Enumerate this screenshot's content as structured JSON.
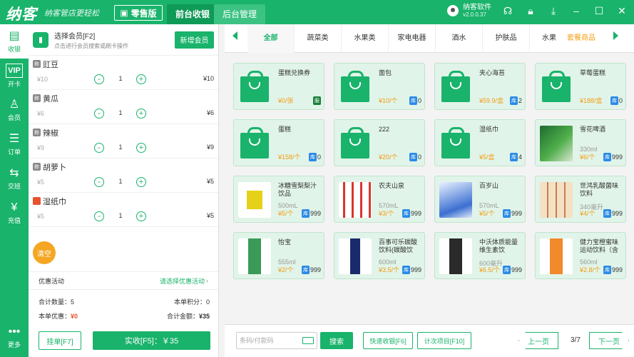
{
  "topbar": {
    "logo": "纳客",
    "slogan": "纳客管店更轻松",
    "edition": "零售版",
    "tabs": [
      "前台收银",
      "后台管理"
    ],
    "user_name": "纳客软件",
    "version": "v2.0.0.37",
    "icons": [
      "headset-icon",
      "lock-icon",
      "download-icon",
      "minimize-icon",
      "maximize-icon",
      "close-icon"
    ]
  },
  "sidebar": {
    "items": [
      {
        "label": "收银",
        "icon": "cashier-icon"
      },
      {
        "label": "开卡",
        "icon": "vip-icon"
      },
      {
        "label": "会员",
        "icon": "member-icon"
      },
      {
        "label": "订单",
        "icon": "order-icon"
      },
      {
        "label": "交班",
        "icon": "shift-icon"
      },
      {
        "label": "充值",
        "icon": "recharge-icon"
      }
    ],
    "more": "更多"
  },
  "member": {
    "title": "选择会员[F2]",
    "subtitle": "点击进行会员搜索或刷卡操作",
    "add_button": "新增会员"
  },
  "cart": {
    "items": [
      {
        "tag": "称",
        "name": "豇豆",
        "price": "¥10",
        "qty": "1",
        "total": "¥10"
      },
      {
        "tag": "称",
        "name": "黄瓜",
        "price": "¥6",
        "qty": "1",
        "total": "¥6"
      },
      {
        "tag": "称",
        "name": "辣椒",
        "price": "¥9",
        "qty": "1",
        "total": "¥9"
      },
      {
        "tag": "称",
        "name": "胡萝卜",
        "price": "¥5",
        "qty": "1",
        "total": "¥5"
      },
      {
        "tag": "普",
        "name": "湿纸巾",
        "price": "¥5",
        "qty": "1",
        "total": "¥5"
      }
    ],
    "clear": "清空",
    "promo_label": "优惠活动",
    "promo_link": "请选择优惠活动",
    "total_qty_label": "合计数量：",
    "total_qty": "5",
    "points_label": "本单积分：",
    "points": "0",
    "discount_label": "本单优惠：",
    "discount": "¥0",
    "total_amount_label": "合计金额：",
    "total_amount": "¥35",
    "hang_button": "挂单[F7]",
    "pay_button": "实收[F5]：￥35"
  },
  "categories": {
    "items": [
      "全部",
      "蔬菜类",
      "水果类",
      "家电电器",
      "酒水",
      "护肤品",
      "水果"
    ],
    "active": "全部",
    "extra": "套餐商品"
  },
  "products": [
    {
      "name": "蛋糕兑换券",
      "spec": "",
      "price": "¥0/张",
      "badge": "服",
      "stock": ""
    },
    {
      "name": "面包",
      "spec": "",
      "price": "¥10/个",
      "badge": "库",
      "stock": "0"
    },
    {
      "name": "夹心海苔",
      "spec": "",
      "price": "¥59.9/盒",
      "badge": "库",
      "stock": "2"
    },
    {
      "name": "草莓蛋糕",
      "spec": "",
      "price": "¥188/盒",
      "badge": "库",
      "stock": "0"
    },
    {
      "name": "蛋糕",
      "spec": "",
      "price": "¥158/个",
      "badge": "库",
      "stock": "0"
    },
    {
      "name": "222",
      "spec": "",
      "price": "¥20/个",
      "badge": "库",
      "stock": "0"
    },
    {
      "name": "湿纸巾",
      "spec": "",
      "price": "¥5/盒",
      "badge": "库",
      "stock": "4"
    },
    {
      "name": "雪花啤酒",
      "spec": "330ml",
      "price": "¥6/个",
      "badge": "库",
      "stock": "999"
    },
    {
      "name": "冰糖雪梨梨汁饮品",
      "spec": "500mL",
      "price": "¥5/个",
      "badge": "库",
      "stock": "999"
    },
    {
      "name": "农夫山泉",
      "spec": "570mL",
      "price": "¥3/个",
      "badge": "库",
      "stock": "999"
    },
    {
      "name": "百岁山",
      "spec": "570mL",
      "price": "¥5/个",
      "badge": "库",
      "stock": "999"
    },
    {
      "name": "世鸿乳酸菌味饮料",
      "spec": "340毫升",
      "price": "¥4/个",
      "badge": "库",
      "stock": "999"
    },
    {
      "name": "怡宝",
      "spec": "555ml",
      "price": "¥2/个",
      "badge": "库",
      "stock": "999"
    },
    {
      "name": "百事可乐碳酸饮料(碳酸饮",
      "spec": "600ml",
      "price": "¥3.5/个",
      "badge": "库",
      "stock": "999"
    },
    {
      "name": "中沃体质能量维生素饮",
      "spec": "600毫升",
      "price": "¥6.5/个",
      "badge": "库",
      "stock": "999"
    },
    {
      "name": "健力宝橙蜜味运动饮料（含",
      "spec": "560ml",
      "price": "¥2.8/个",
      "badge": "库",
      "stock": "999"
    }
  ],
  "bottom": {
    "search_placeholder": "条码/付款码",
    "search_button": "搜索",
    "quick_cash": "快速收银[F6]",
    "count_item": "计次项目[F10]",
    "prev": "上一页",
    "page_info": "3/7",
    "next": "下一页"
  },
  "colors": {
    "brand": "#19b36b",
    "price": "#f39c12",
    "stock_badge": "#2b8be6",
    "red": "#e8522f"
  }
}
